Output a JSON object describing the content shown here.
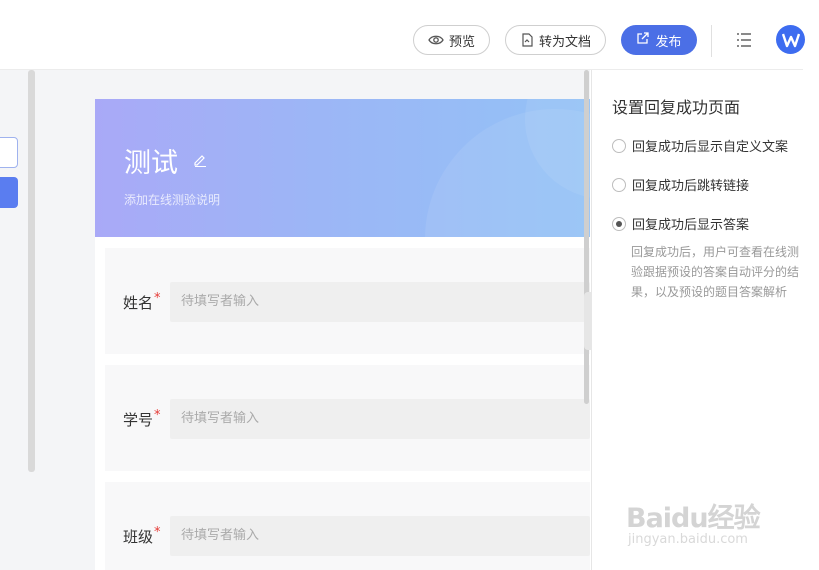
{
  "toolbar": {
    "preview_label": "预览",
    "convert_label": "转为文档",
    "publish_label": "发布",
    "menu_icon": "menu-icon",
    "logo_icon": "wps-logo-icon",
    "accent_color": "#4b6fe6"
  },
  "form": {
    "title": "测试",
    "description": "添加在线测验说明",
    "fields": [
      {
        "label": "姓名",
        "placeholder": "待填写者输入"
      },
      {
        "label": "学号",
        "placeholder": "待填写者输入"
      },
      {
        "label": "班级",
        "placeholder": "待填写者输入"
      }
    ]
  },
  "panel": {
    "title": "设置回复成功页面",
    "options": [
      {
        "label": "回复成功后显示自定义文案",
        "checked": false
      },
      {
        "label": "回复成功后跳转链接",
        "checked": false
      },
      {
        "label": "回复成功后显示答案",
        "checked": true
      }
    ],
    "description": "回复成功后，用户可查看在线测验跟据预设的答案自动评分的结果，以及预设的题目答案解析"
  },
  "watermark": {
    "main": "Baidu经验",
    "sub": "jingyan.baidu.com"
  }
}
